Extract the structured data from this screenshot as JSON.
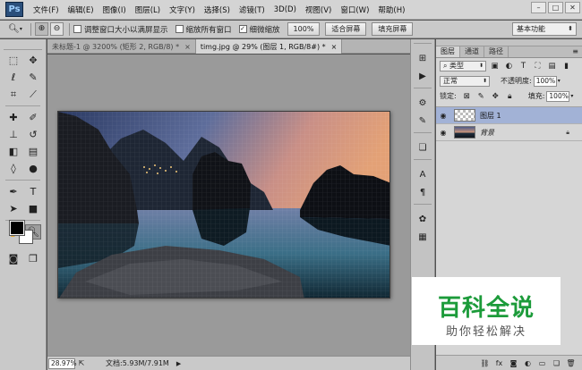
{
  "menubar": {
    "logo": "Ps",
    "items": [
      "文件(F)",
      "编辑(E)",
      "图像(I)",
      "图层(L)",
      "文字(Y)",
      "选择(S)",
      "滤镜(T)",
      "3D(D)",
      "视图(V)",
      "窗口(W)",
      "帮助(H)"
    ]
  },
  "options": {
    "resize_windows_label": "调整窗口大小以满屏显示",
    "resize_windows_checked": false,
    "zoom_all_label": "缩放所有窗口",
    "zoom_all_checked": false,
    "scrubby_zoom_label": "细微缩放",
    "scrubby_zoom_checked": true,
    "actual_pixels_label": "100%",
    "fit_screen_label": "适合屏幕",
    "fill_screen_label": "填充屏幕",
    "workspace": "基本功能"
  },
  "tabs": [
    {
      "label": "未标题-1 @ 3200% (矩形 2, RGB/8) *",
      "active": false
    },
    {
      "label": "timg.jpg @ 29% (图层 1, RGB/8#) *",
      "active": true
    }
  ],
  "status": {
    "zoom": "28.97%",
    "doc_info": "文档:5.93M/7.91M"
  },
  "layers_panel": {
    "tabs": [
      "图层",
      "通道",
      "路径"
    ],
    "filter_kind": "类型",
    "blend_mode": "正常",
    "opacity_label": "不透明度:",
    "opacity_value": "100%",
    "lock_label": "锁定:",
    "fill_label": "填充:",
    "fill_value": "100%",
    "layers": [
      {
        "name": "图层 1",
        "selected": true,
        "italic": false,
        "locked": false
      },
      {
        "name": "背景",
        "selected": false,
        "italic": true,
        "locked": true
      }
    ]
  },
  "watermark": {
    "title": "百科全说",
    "subtitle": "助你轻松解决"
  },
  "colors": {
    "foreground": "#000000",
    "background": "#ffffff",
    "watermark_green": "#1c9b3a",
    "selected_layer": "#a2b2d6"
  }
}
